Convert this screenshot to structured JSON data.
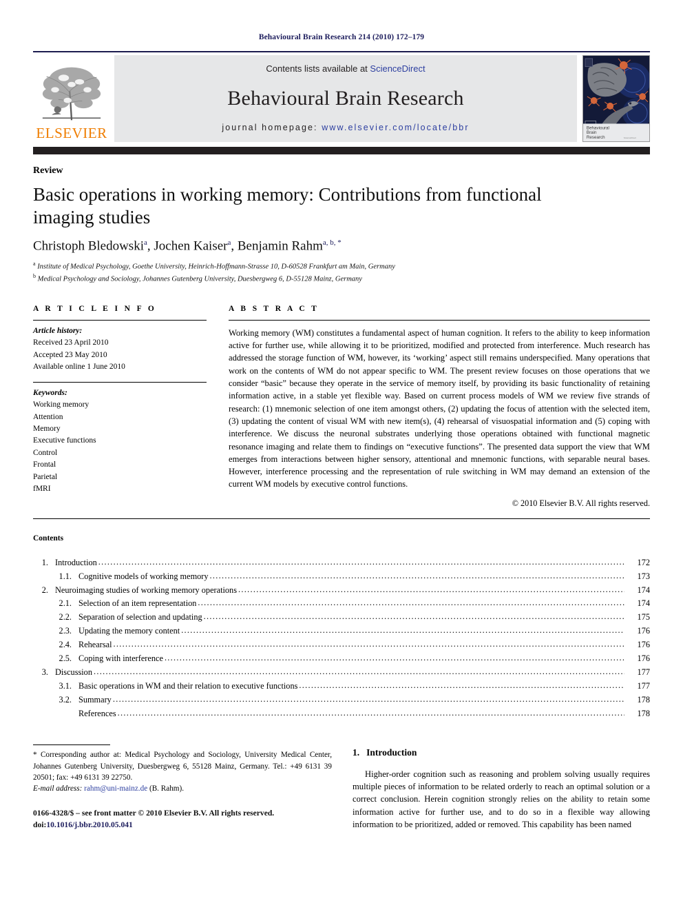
{
  "running_head": "Behavioural Brain Research 214 (2010) 172–179",
  "masthead": {
    "contents_line_prefix": "Contents lists available at ",
    "sciencedirect_link": "ScienceDirect",
    "journal_title": "Behavioural Brain Research",
    "homepage_label": "journal homepage:",
    "homepage_url": "www.elsevier.com/locate/bbr",
    "publisher_wordmark": "ELSEVIER",
    "cover_title_line1": "Behavioural",
    "cover_title_line2": "Brain",
    "cover_title_line3": "Research",
    "link_color": "#2d3fa0",
    "banner_bg": "#e6e7e8",
    "wordmark_color": "#ef7d00",
    "bar_color": "#231f20"
  },
  "article": {
    "doctype": "Review",
    "title": "Basic operations in working memory: Contributions from functional imaging studies",
    "authors": [
      {
        "name": "Christoph Bledowski",
        "sup": "a"
      },
      {
        "name": "Jochen Kaiser",
        "sup": "a"
      },
      {
        "name": "Benjamin Rahm",
        "sup": "a, b, *"
      }
    ],
    "affiliations": [
      {
        "marker": "a",
        "text": "Institute of Medical Psychology, Goethe University, Heinrich-Hoffmann-Strasse 10, D-60528 Frankfurt am Main, Germany"
      },
      {
        "marker": "b",
        "text": "Medical Psychology and Sociology, Johannes Gutenberg University, Duesbergweg 6, D-55128 Mainz, Germany"
      }
    ]
  },
  "article_info": {
    "heading": "A R T I C L E  I N F O",
    "history_label": "Article history:",
    "history": [
      "Received 23 April 2010",
      "Accepted 23 May 2010",
      "Available online 1 June 2010"
    ],
    "keywords_label": "Keywords:",
    "keywords": [
      "Working memory",
      "Attention",
      "Memory",
      "Executive functions",
      "Control",
      "Frontal",
      "Parietal",
      "fMRI"
    ]
  },
  "abstract": {
    "heading": "A B S T R A C T",
    "text": "Working memory (WM) constitutes a fundamental aspect of human cognition. It refers to the ability to keep information active for further use, while allowing it to be prioritized, modified and protected from interference. Much research has addressed the storage function of WM, however, its ‘working’ aspect still remains underspecified. Many operations that work on the contents of WM do not appear specific to WM. The present review focuses on those operations that we consider “basic” because they operate in the service of memory itself, by providing its basic functionality of retaining information active, in a stable yet flexible way. Based on current process models of WM we review five strands of research: (1) mnemonic selection of one item amongst others, (2) updating the focus of attention with the selected item, (3) updating the content of visual WM with new item(s), (4) rehearsal of visuospatial information and (5) coping with interference. We discuss the neuronal substrates underlying those operations obtained with functional magnetic resonance imaging and relate them to findings on “executive functions”. The presented data support the view that WM emerges from interactions between higher sensory, attentional and mnemonic functions, with separable neural bases. However, interference processing and the representation of rule switching in WM may demand an extension of the current WM models by executive control functions.",
    "copyright": "© 2010 Elsevier B.V. All rights reserved."
  },
  "contents": {
    "heading": "Contents",
    "entries": [
      {
        "level": 1,
        "num": "1.",
        "label": "Introduction",
        "page": "172"
      },
      {
        "level": 2,
        "num": "1.1.",
        "label": "Cognitive models of working memory",
        "page": "173"
      },
      {
        "level": 1,
        "num": "2.",
        "label": "Neuroimaging studies of working memory operations",
        "page": "174"
      },
      {
        "level": 2,
        "num": "2.1.",
        "label": "Selection of an item representation",
        "page": "174"
      },
      {
        "level": 2,
        "num": "2.2.",
        "label": "Separation of selection and updating",
        "page": "175"
      },
      {
        "level": 2,
        "num": "2.3.",
        "label": "Updating the memory content",
        "page": "176"
      },
      {
        "level": 2,
        "num": "2.4.",
        "label": "Rehearsal",
        "page": "176"
      },
      {
        "level": 2,
        "num": "2.5.",
        "label": "Coping with interference",
        "page": "176"
      },
      {
        "level": 1,
        "num": "3.",
        "label": "Discussion",
        "page": "177"
      },
      {
        "level": 2,
        "num": "3.1.",
        "label": "Basic operations in WM and their relation to executive functions",
        "page": "177"
      },
      {
        "level": 2,
        "num": "3.2.",
        "label": "Summary",
        "page": "178"
      },
      {
        "level": 3,
        "num": "",
        "label": "References",
        "page": "178"
      }
    ]
  },
  "introduction": {
    "number": "1.",
    "heading": "Introduction",
    "paragraph": "Higher-order cognition such as reasoning and problem solving usually requires multiple pieces of information to be related orderly to reach an optimal solution or a correct conclusion. Herein cognition strongly relies on the ability to retain some information active for further use, and to do so in a flexible way allowing information to be prioritized, added or removed. This capability has been named"
  },
  "footnote": {
    "star": "*",
    "correspondence": "Corresponding author at: Medical Psychology and Sociology, University Medical Center, Johannes Gutenberg University, Duesbergweg 6, 55128 Mainz, Germany. Tel.: +49 6131 39 20501; fax: +49 6131 39 22750.",
    "email_label": "E-mail address:",
    "email": "rahm@uni-mainz.de",
    "email_owner": "(B. Rahm)."
  },
  "imprint": {
    "issn_line": "0166-4328/$ – see front matter © 2010 Elsevier B.V. All rights reserved.",
    "doi_prefix": "doi:",
    "doi": "10.1016/j.bbr.2010.05.041"
  }
}
